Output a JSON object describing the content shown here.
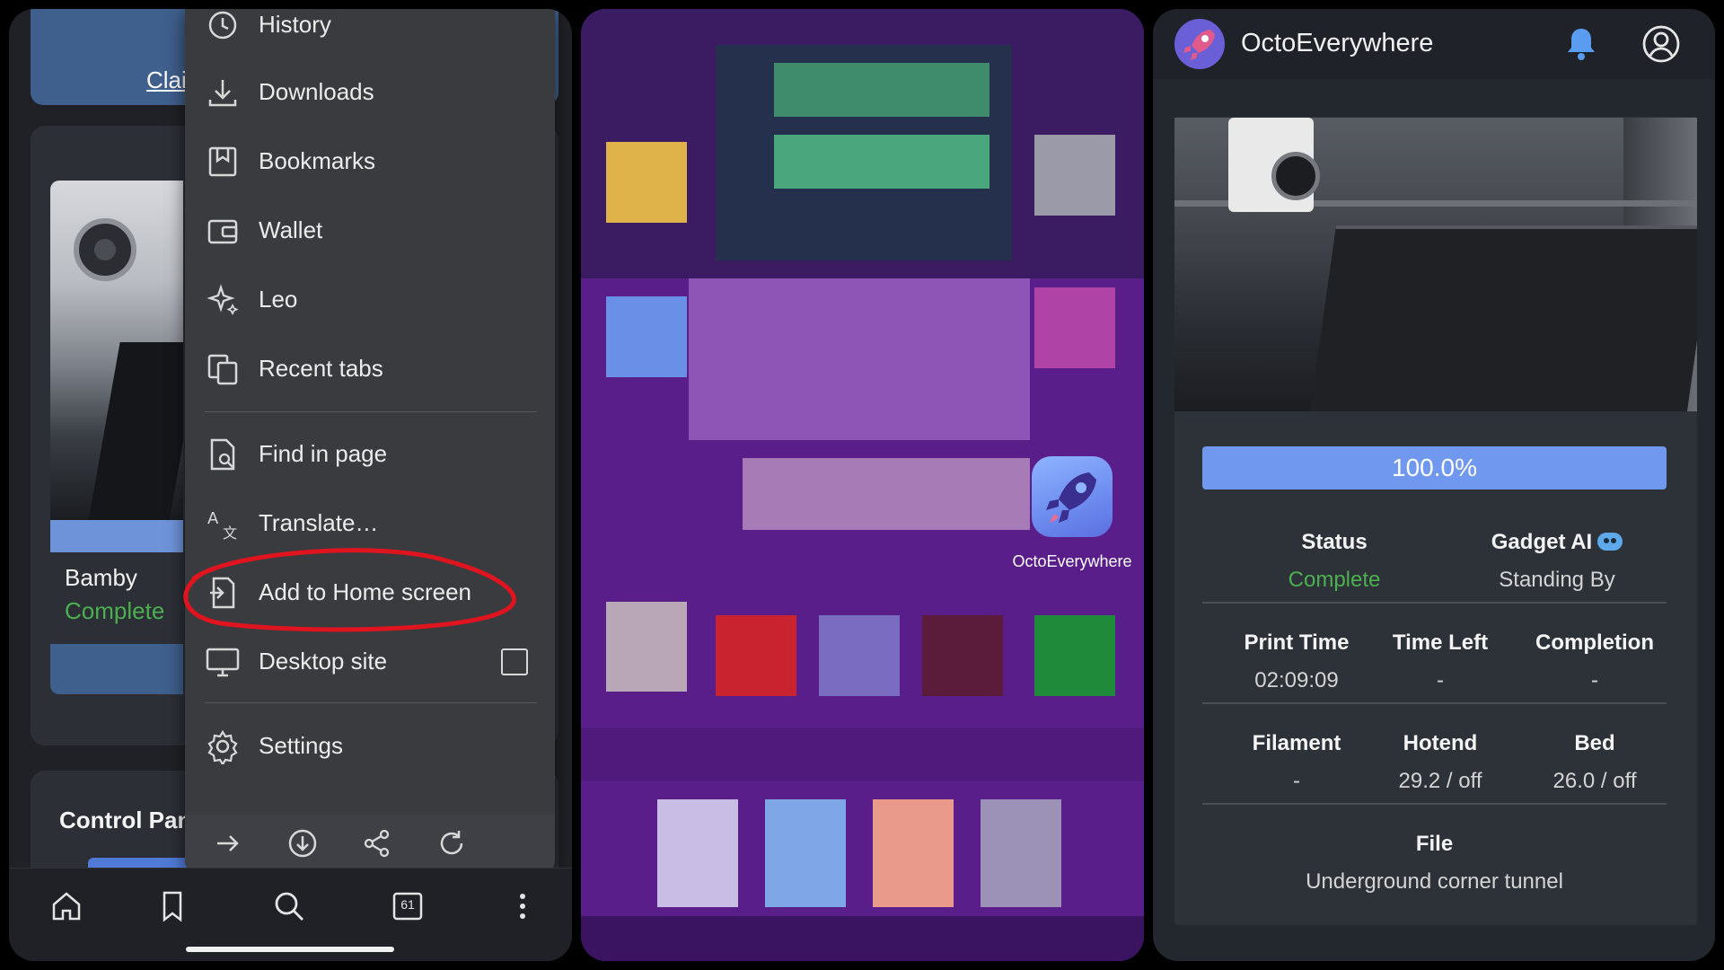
{
  "browser_panel": {
    "top_link": "Clai",
    "printer_name": "Bamby",
    "printer_status": "Complete",
    "control_panel_title": "Control Pan",
    "menu": {
      "items": [
        {
          "label": "History",
          "icon": "history-icon"
        },
        {
          "label": "Downloads",
          "icon": "download-icon"
        },
        {
          "label": "Bookmarks",
          "icon": "bookmarks-icon"
        },
        {
          "label": "Wallet",
          "icon": "wallet-icon"
        },
        {
          "label": "Leo",
          "icon": "leo-sparkle-icon"
        },
        {
          "label": "Recent tabs",
          "icon": "recent-tabs-icon"
        },
        {
          "label": "Find in page",
          "icon": "find-in-page-icon"
        },
        {
          "label": "Translate…",
          "icon": "translate-icon"
        },
        {
          "label": "Add to Home screen",
          "icon": "add-to-home-icon"
        },
        {
          "label": "Desktop site",
          "icon": "desktop-icon",
          "checked": false
        },
        {
          "label": "Settings",
          "icon": "gear-icon"
        }
      ]
    },
    "tab_count": "61"
  },
  "home_screen": {
    "app_label": "OctoEverywhere"
  },
  "octo_panel": {
    "title": "OctoEverywhere",
    "progress": 1.0,
    "progress_text": "100.0%",
    "status_label": "Status",
    "status_value": "Complete",
    "gadget_label": "Gadget AI",
    "gadget_value": "Standing By",
    "print_time_label": "Print Time",
    "print_time_value": "02:09:09",
    "time_left_label": "Time Left",
    "time_left_value": "-",
    "completion_label": "Completion",
    "completion_value": "-",
    "filament_label": "Filament",
    "filament_value": "-",
    "hotend_label": "Hotend",
    "hotend_value": "29.2 / off",
    "bed_label": "Bed",
    "bed_value": "26.0 / off",
    "file_label": "File",
    "file_value": "Underground corner tunnel",
    "colors": {
      "accent": "#6f98ee",
      "success": "#4caf50"
    }
  }
}
